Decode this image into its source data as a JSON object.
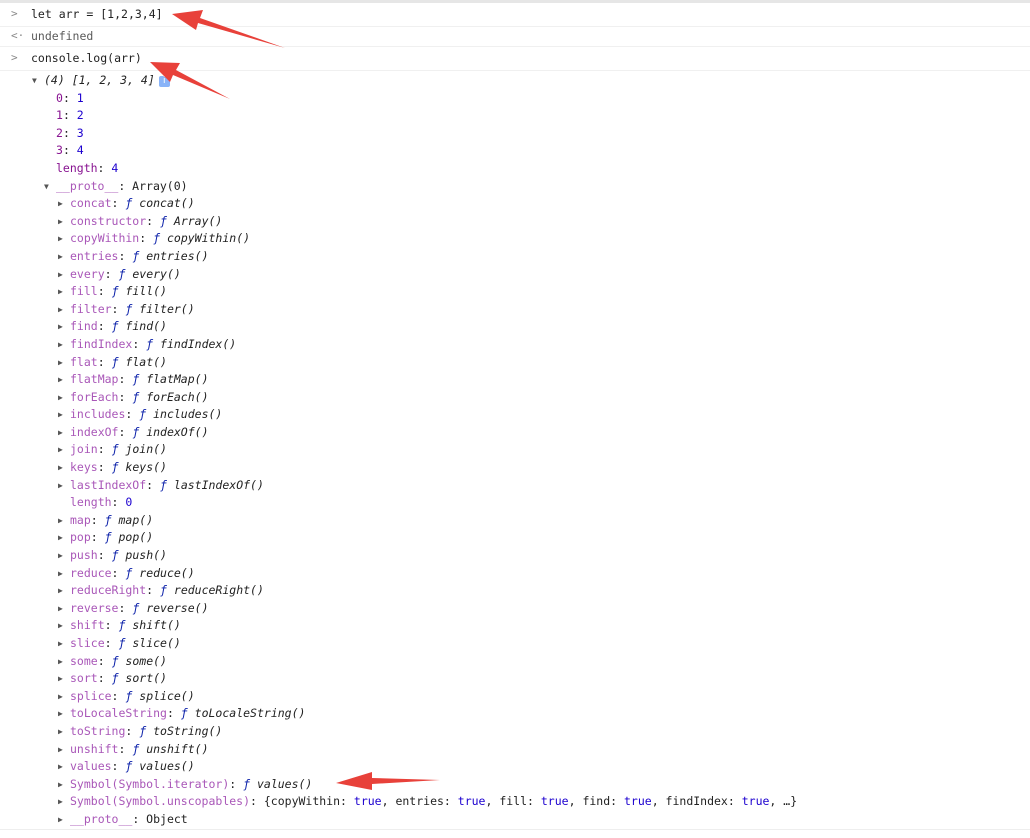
{
  "console": {
    "input1": {
      "prompt_icon": "chevron-right-icon",
      "code_prefix": "let arr = ",
      "code_value": "[1,2,3,4]"
    },
    "result1": {
      "prompt_icon": "return-arrow-icon",
      "text": "undefined"
    },
    "input2": {
      "prompt_icon": "chevron-right-icon",
      "code": "console.log(arr)"
    }
  },
  "array_output": {
    "preview": "(4) [1, 2, 3, 4]",
    "info_badge": "i",
    "items": [
      {
        "key": "0",
        "value": "1"
      },
      {
        "key": "1",
        "value": "2"
      },
      {
        "key": "2",
        "value": "3"
      },
      {
        "key": "3",
        "value": "4"
      }
    ],
    "length_key": "length",
    "length_value": "4",
    "proto_key": "__proto__",
    "proto_value": "Array(0)",
    "proto_members": [
      {
        "key": "concat",
        "fn": "concat()"
      },
      {
        "key": "constructor",
        "fn": "Array()"
      },
      {
        "key": "copyWithin",
        "fn": "copyWithin()"
      },
      {
        "key": "entries",
        "fn": "entries()"
      },
      {
        "key": "every",
        "fn": "every()"
      },
      {
        "key": "fill",
        "fn": "fill()"
      },
      {
        "key": "filter",
        "fn": "filter()"
      },
      {
        "key": "find",
        "fn": "find()"
      },
      {
        "key": "findIndex",
        "fn": "findIndex()"
      },
      {
        "key": "flat",
        "fn": "flat()"
      },
      {
        "key": "flatMap",
        "fn": "flatMap()"
      },
      {
        "key": "forEach",
        "fn": "forEach()"
      },
      {
        "key": "includes",
        "fn": "includes()"
      },
      {
        "key": "indexOf",
        "fn": "indexOf()"
      },
      {
        "key": "join",
        "fn": "join()"
      },
      {
        "key": "keys",
        "fn": "keys()"
      },
      {
        "key": "lastIndexOf",
        "fn": "lastIndexOf()"
      }
    ],
    "proto_length_key": "length",
    "proto_length_value": "0",
    "proto_members2": [
      {
        "key": "map",
        "fn": "map()"
      },
      {
        "key": "pop",
        "fn": "pop()"
      },
      {
        "key": "push",
        "fn": "push()"
      },
      {
        "key": "reduce",
        "fn": "reduce()"
      },
      {
        "key": "reduceRight",
        "fn": "reduceRight()"
      },
      {
        "key": "reverse",
        "fn": "reverse()"
      },
      {
        "key": "shift",
        "fn": "shift()"
      },
      {
        "key": "slice",
        "fn": "slice()"
      },
      {
        "key": "some",
        "fn": "some()"
      },
      {
        "key": "sort",
        "fn": "sort()"
      },
      {
        "key": "splice",
        "fn": "splice()"
      },
      {
        "key": "toLocaleString",
        "fn": "toLocaleString()"
      },
      {
        "key": "toString",
        "fn": "toString()"
      },
      {
        "key": "unshift",
        "fn": "unshift()"
      },
      {
        "key": "values",
        "fn": "values()"
      },
      {
        "key": "Symbol(Symbol.iterator)",
        "fn": "values()"
      }
    ],
    "unscopables_key": "Symbol(Symbol.unscopables)",
    "unscopables_preview": [
      {
        "k": "copyWithin",
        "v": "true"
      },
      {
        "k": "entries",
        "v": "true"
      },
      {
        "k": "fill",
        "v": "true"
      },
      {
        "k": "find",
        "v": "true"
      },
      {
        "k": "findIndex",
        "v": "true"
      }
    ],
    "unscopables_ellipsis": "…}",
    "proto2_key": "__proto__",
    "proto2_value": "Object",
    "f_symbol": "ƒ"
  },
  "colors": {
    "annotation_arrow": "#e8413a",
    "key": "#881391",
    "number": "#1c00cf"
  }
}
